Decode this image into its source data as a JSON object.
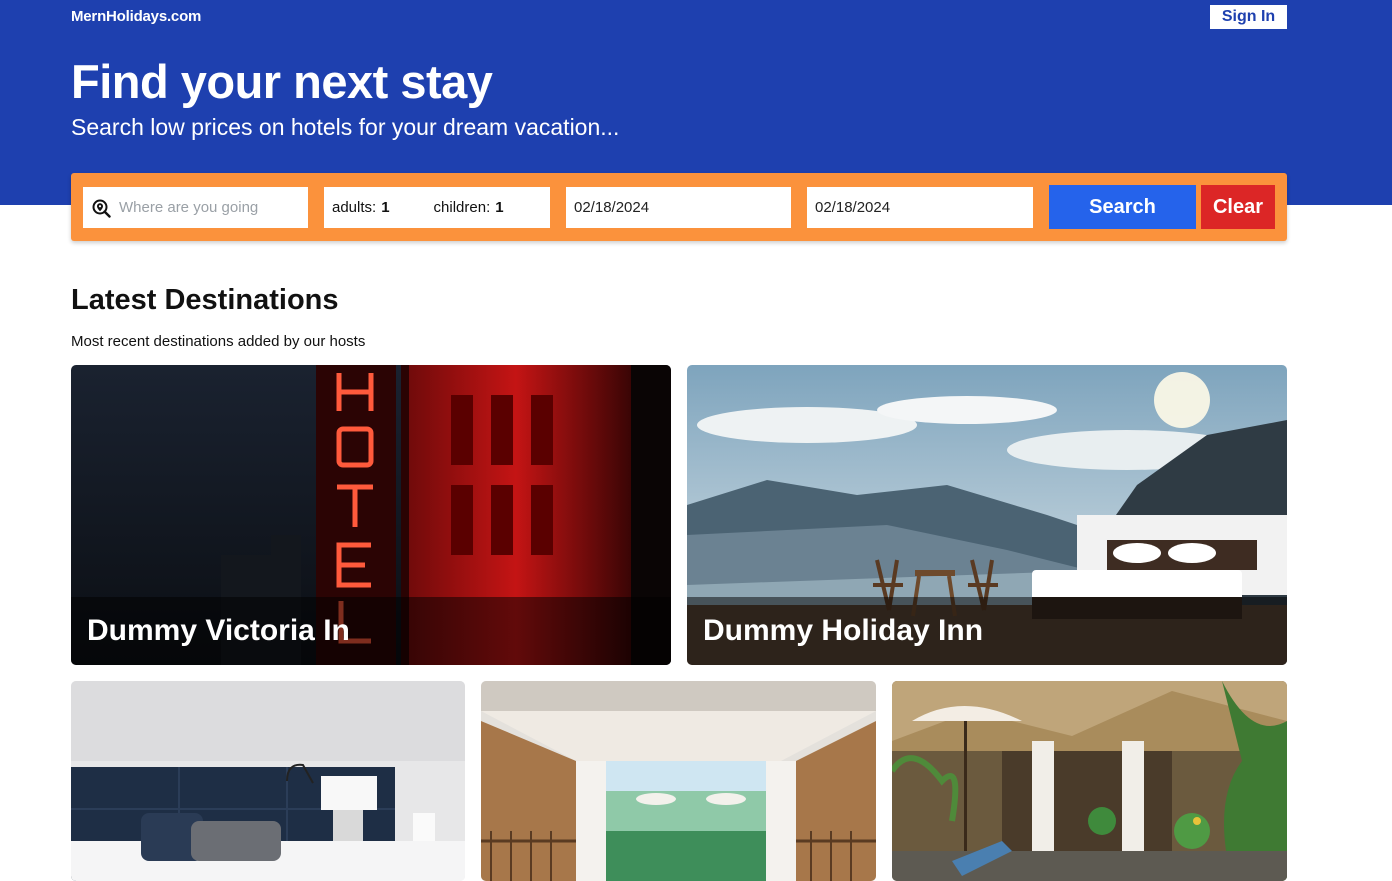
{
  "header": {
    "brand": "MernHolidays.com",
    "signin_label": "Sign In"
  },
  "hero": {
    "title": "Find your next stay",
    "subtitle": "Search low prices on hotels for your dream vacation..."
  },
  "search": {
    "destination_placeholder": "Where are you going",
    "adults_label": "adults:",
    "adults_value": "1",
    "children_label": "children:",
    "children_value": "1",
    "check_in": "02/18/2024",
    "check_out": "02/18/2024",
    "search_label": "Search",
    "clear_label": "Clear"
  },
  "destinations": {
    "title": "Latest Destinations",
    "subtitle": "Most recent destinations added by our hosts",
    "cards": [
      {
        "name": "Dummy Victoria In"
      },
      {
        "name": "Dummy Holiday Inn"
      },
      {
        "name": ""
      },
      {
        "name": ""
      },
      {
        "name": ""
      }
    ]
  },
  "colors": {
    "hero_bg": "#1e40af",
    "search_bar_bg": "#fb923c",
    "search_button": "#2563eb",
    "clear_button": "#dc2626"
  },
  "icons": {
    "destination": "search-location-icon"
  }
}
